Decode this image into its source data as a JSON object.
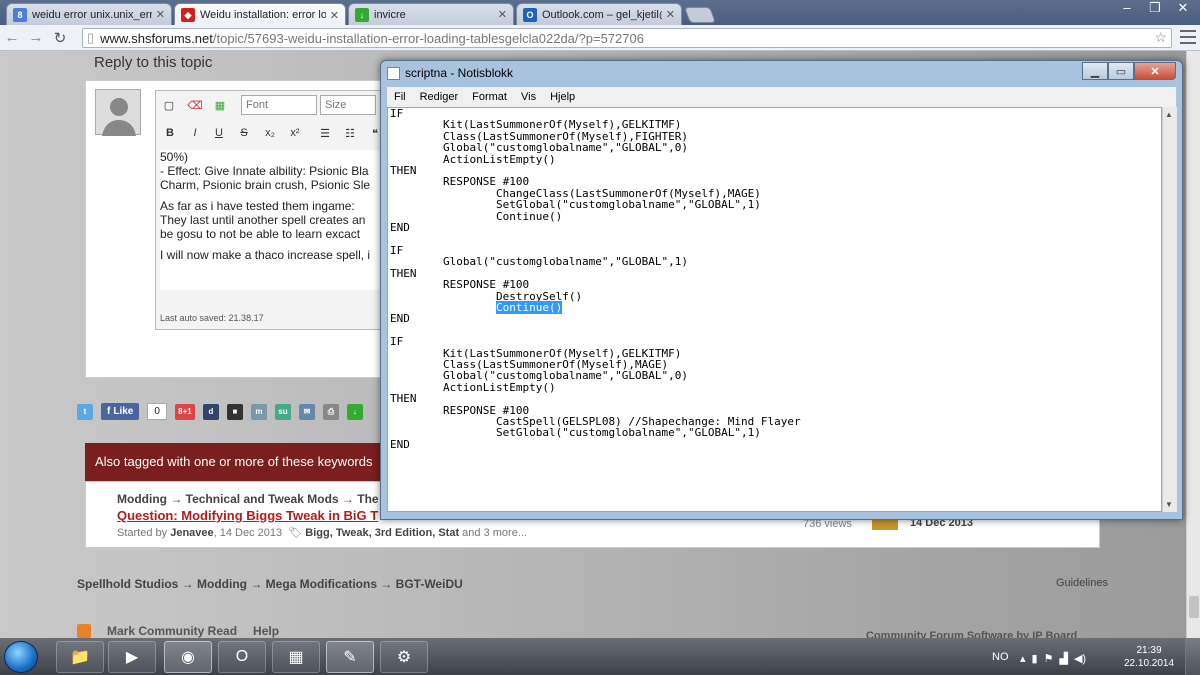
{
  "browser": {
    "tabs": [
      {
        "label": "weidu error unix.unix_erro",
        "icon": "google-icon",
        "active": false
      },
      {
        "label": "Weidu installation: error lo",
        "icon": "dragon-icon",
        "active": true
      },
      {
        "label": "invicre",
        "icon": "download-icon",
        "active": false
      },
      {
        "label": "Outlook.com – gel_kjetil@",
        "icon": "outlook-icon",
        "active": false
      }
    ],
    "url_host": "www.shsforums.net",
    "url_path": "/topic/57693-weidu-installation-error-loading-tablesgelcla022da/?p=572706"
  },
  "forum": {
    "reply_title": "Reply to this topic",
    "font_select": "Font",
    "size_select": "Size",
    "editor_lines": [
      "50%)",
      "- Effect: Give Innate albility: Psionic Bla",
      "Charm, Psionic brain crush, Psionic Sle",
      "As far as i have tested them ingame:",
      "They last until another spell creates an",
      "be gosu to not be able to learn excact",
      "I will now make a thaco increase spell, i"
    ],
    "autosave": "Last auto saved: 21.38.17",
    "like_label": "Like",
    "like_count": "0",
    "gplus_label": "8+1",
    "tagged_title": "Also tagged with one or more of these keywords",
    "crumb": "Modding → Technical and Tweak Mods → The b",
    "topic_link": "Question: Modifying Biggs Tweak in BiG T",
    "started_by_prefix": "Started by",
    "started_by_name": "Jenavee",
    "started_date": ", 14 Dec 2013",
    "tags": "Bigg, Tweak, 3rd Edition, Stat",
    "tags_more": "and 3 more...",
    "views": "736 views",
    "last_date": "14 Dec 2013",
    "bottom_crumb": "Spellhold Studios → Modding → Mega Modifications → BGT-WeiDU",
    "guidelines": "Guidelines",
    "footer_mark": "Mark Community Read",
    "footer_help": "Help",
    "footer_right": "Community Forum Software by IP Board"
  },
  "notepad": {
    "title": "scriptna - Notisblokk",
    "menu": [
      "Fil",
      "Rediger",
      "Format",
      "Vis",
      "Hjelp"
    ],
    "code_before": "IF\n\tKit(LastSummonerOf(Myself),GELKITMF)\n\tClass(LastSummonerOf(Myself),FIGHTER)\n\tGlobal(\"customglobalname\",\"GLOBAL\",0)\n\tActionListEmpty()\nTHEN\n\tRESPONSE #100\n\t\tChangeClass(LastSummonerOf(Myself),MAGE)\n\t\tSetGlobal(\"customglobalname\",\"GLOBAL\",1)\n\t\tContinue()\nEND\n\nIF\n\tGlobal(\"customglobalname\",\"GLOBAL\",1)\nTHEN\n\tRESPONSE #100\n\t\tDestroySelf()\n\t\t",
    "code_selected": "Continue()",
    "code_after": "\nEND\n\nIF\n\tKit(LastSummonerOf(Myself),GELKITMF)\n\tClass(LastSummonerOf(Myself),MAGE)\n\tGlobal(\"customglobalname\",\"GLOBAL\",0)\n\tActionListEmpty()\nTHEN\n\tRESPONSE #100\n\t\tCastSpell(GELSPL08) //Shapechange: Mind Flayer\n\t\tSetGlobal(\"customglobalname\",\"GLOBAL\",1)\nEND"
  },
  "taskbar": {
    "lang": "NO",
    "time": "21:39",
    "date": "22.10.2014"
  }
}
